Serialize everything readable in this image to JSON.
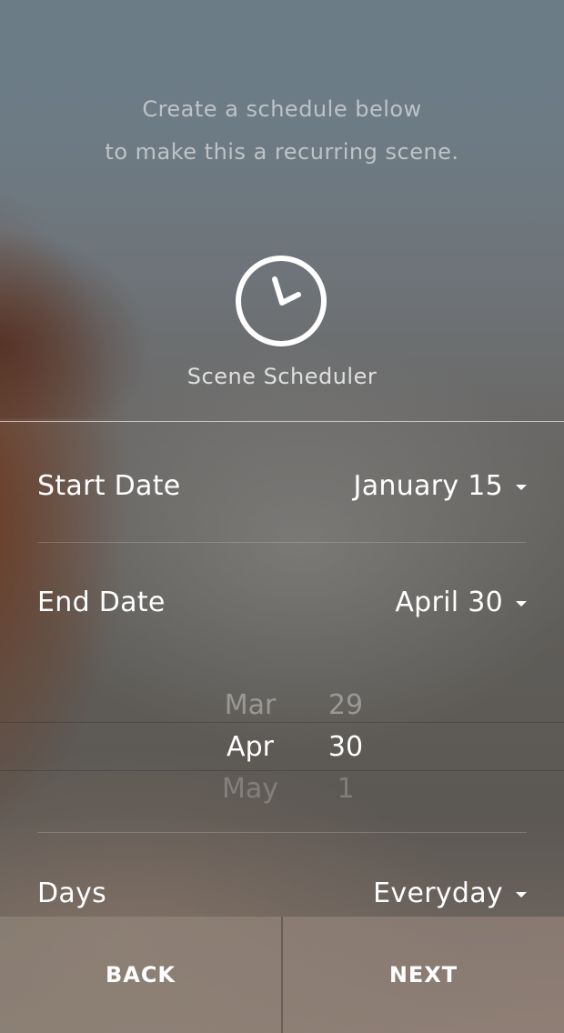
{
  "intro": {
    "line1": "Create a schedule below",
    "line2": "to make this a recurring scene."
  },
  "header": {
    "icon": "clock-icon",
    "title": "Scene Scheduler"
  },
  "fields": {
    "start_date": {
      "label": "Start Date",
      "value": "January 15"
    },
    "end_date": {
      "label": "End Date",
      "value": "April 30"
    },
    "days": {
      "label": "Days",
      "value": "Everyday"
    }
  },
  "picker": {
    "prev": {
      "month": "Mar",
      "day": "29"
    },
    "selected": {
      "month": "Apr",
      "day": "30"
    },
    "next": {
      "month": "May",
      "day": "1"
    }
  },
  "footer": {
    "back_label": "BACK",
    "next_label": "NEXT"
  }
}
